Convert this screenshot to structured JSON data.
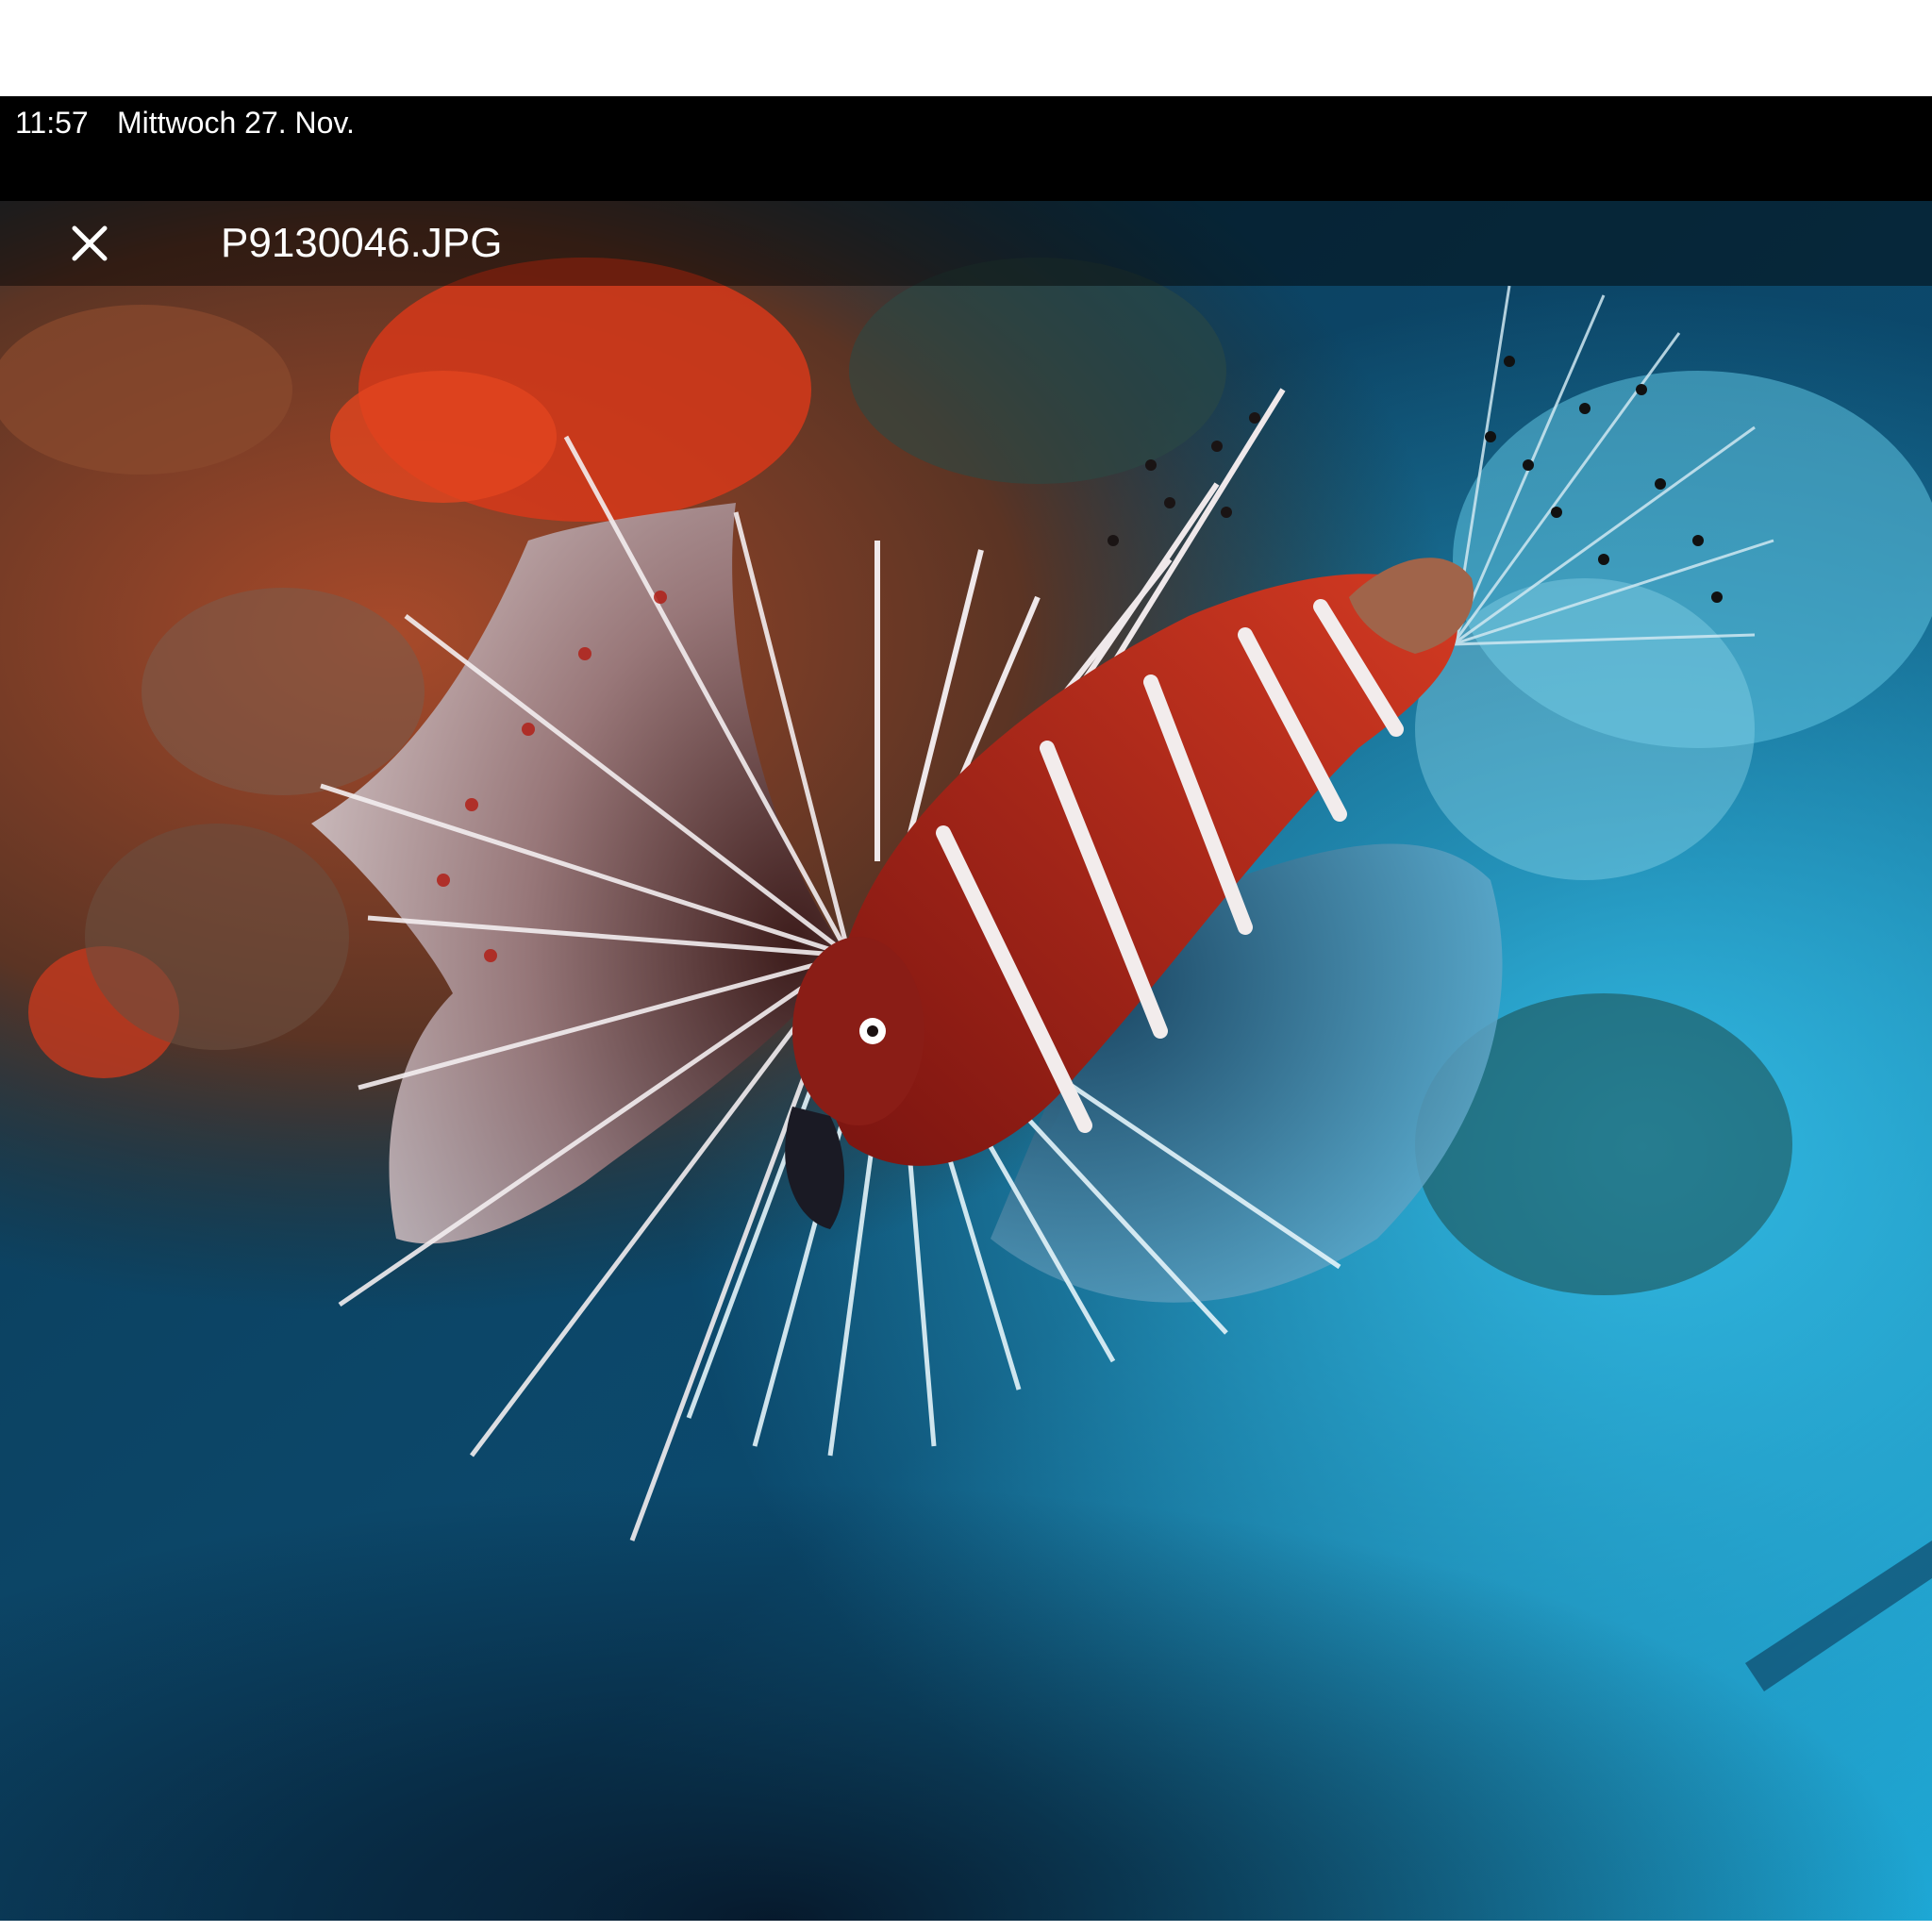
{
  "status_bar": {
    "time": "11:57",
    "date": "Mittwoch 27. Nov."
  },
  "viewer": {
    "file_name": "P9130046.JPG",
    "close_icon": "close-icon"
  },
  "colors": {
    "status_bar_bg": "#000000",
    "toolbar_text": "#ffffff",
    "fish_red": "#c8281a",
    "water_blue": "#1aa8d8"
  }
}
